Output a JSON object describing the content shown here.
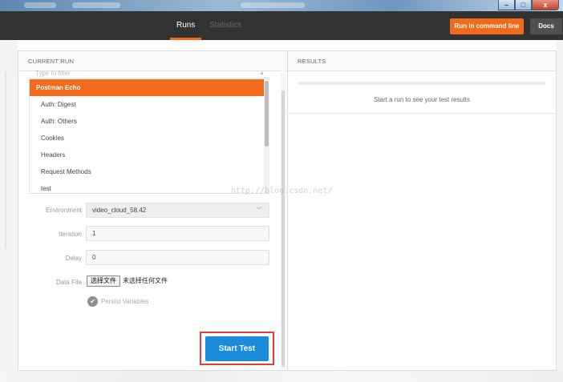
{
  "window": {
    "controls": {
      "minimize": "–",
      "maximize": "□",
      "close": "x"
    }
  },
  "header": {
    "tabs": [
      {
        "label": "Runs",
        "active": true
      },
      {
        "label": "Statistics",
        "active": false
      }
    ],
    "run_cmd_label": "Run in command line",
    "docs_label": "Docs",
    "accent_color": "#f26b1d"
  },
  "current_run": {
    "title": "CURRENT RUN",
    "filter_placeholder": "Type to filter",
    "collections": [
      {
        "label": "Postman Echo",
        "selected": true
      },
      {
        "label": "Auth: Digest",
        "selected": false
      },
      {
        "label": "Auth: Others",
        "selected": false
      },
      {
        "label": "Cookies",
        "selected": false
      },
      {
        "label": "Headers",
        "selected": false
      },
      {
        "label": "Request Methods",
        "selected": false
      },
      {
        "label": "test",
        "selected": false
      }
    ],
    "environment": {
      "label": "Environment",
      "value": "video_cloud_58.42"
    },
    "iteration": {
      "label": "Iteration",
      "value": "1"
    },
    "delay": {
      "label": "Delay",
      "value": "0"
    },
    "data_file": {
      "label": "Data File",
      "button": "选择文件",
      "status": "未选择任何文件"
    },
    "persist": {
      "label": "Persist Variables",
      "checked": true
    },
    "start_label": "Start Test"
  },
  "results": {
    "title": "RESULTS",
    "empty_text": "Start a run to see your test results"
  },
  "watermark": "http://blog.csdn.net/"
}
